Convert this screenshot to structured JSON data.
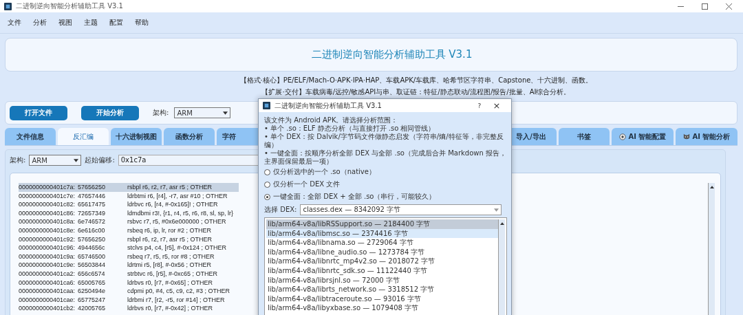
{
  "window": {
    "title": "二进制逆向智能分析辅助工具 V3.1"
  },
  "menu": [
    "文件",
    "分析",
    "视图",
    "主题",
    "配置",
    "帮助"
  ],
  "header": {
    "title": "二进制逆向智能分析辅助工具 V3.1",
    "lines": [
      "【格式·核心】PE/ELF/Mach-O·APK·IPA·HAP、车载APK/车载库、哈希节区字符串、Capstone、十六进制、函数。",
      "【扩展·交付】车载病毒/远控/敏感API与串、取证链：特征/静态联动/流程图/报告/批量、AI综合分析。"
    ]
  },
  "toolbar": {
    "buttons": [
      "打开文件",
      "开始分析"
    ],
    "arch_label": "架构:",
    "arch_value": "ARM"
  },
  "tabs": [
    {
      "label": "文件信息",
      "selected": false,
      "kind": "plain"
    },
    {
      "label": "反汇编",
      "selected": true,
      "kind": "plain"
    },
    {
      "label": "十六进制视图",
      "selected": false,
      "kind": "plain"
    },
    {
      "label": "函数分析",
      "selected": false,
      "kind": "plain"
    },
    {
      "label": "字符",
      "selected": false,
      "kind": "wide"
    },
    {
      "label": "导入/导出",
      "selected": false,
      "kind": "plain"
    },
    {
      "label": "书签",
      "selected": false,
      "kind": "plain"
    },
    {
      "label": "AI 智能配置",
      "selected": false,
      "kind": "gear"
    },
    {
      "label": "AI 智能分析",
      "selected": false,
      "kind": "cat"
    }
  ],
  "disassembly": {
    "arch_label": "架构:",
    "arch_value": "ARM",
    "offset_label": "起始偏移:",
    "offset_value": "0x1c7a",
    "rows": [
      {
        "address": "0000000000401c7a:",
        "bytes": "57656250",
        "instruction": "rsbpl    r6, r2, r7, asr r5  ; OTHER",
        "selected": true
      },
      {
        "address": "0000000000401c7e:",
        "bytes": "47657446",
        "instruction": "ldrbtmi  r6, [r4], -r7, asr #10  ; OTHER",
        "selected": false
      },
      {
        "address": "0000000000401c82:",
        "bytes": "65617475",
        "instruction": "ldrbvc   r6, [r4, #-0x165]!  ; OTHER",
        "selected": false
      },
      {
        "address": "0000000000401c86:",
        "bytes": "72657349",
        "instruction": "ldmdbmi  r3!, {r1, r4, r5, r6, r8, sl, sp, lr}",
        "selected": false
      },
      {
        "address": "0000000000401c8a:",
        "bytes": "6e746572",
        "instruction": "rsbvc    r7, r5, #0x6e000000  ; OTHER",
        "selected": false
      },
      {
        "address": "0000000000401c8e:",
        "bytes": "6e616c00",
        "instruction": "rsbeq    r6, ip, lr, ror #2  ; OTHER",
        "selected": false
      },
      {
        "address": "0000000000401c92:",
        "bytes": "57656250",
        "instruction": "rsbpl    r6, r2, r7, asr r5  ; OTHER",
        "selected": false
      },
      {
        "address": "0000000000401c96:",
        "bytes": "4944656c",
        "instruction": "stclvs   p4, c4, [r5], #-0x124  ; OTHER",
        "selected": false
      },
      {
        "address": "0000000000401c9a:",
        "bytes": "65746500",
        "instruction": "rsbeq    r7, r5, r5, ror #8  ; OTHER",
        "selected": false
      },
      {
        "address": "0000000000401c9e:",
        "bytes": "56503844",
        "instruction": "ldrtmi   r5, [r8], #-0x56  ; OTHER",
        "selected": false
      },
      {
        "address": "0000000000401ca2:",
        "bytes": "656c6574",
        "instruction": "strbtvc  r6, [r5], #-0xc65  ; OTHER",
        "selected": false
      },
      {
        "address": "0000000000401ca6:",
        "bytes": "65005765",
        "instruction": "ldrbvs   r0, [r7, #-0x65]  ; OTHER",
        "selected": false
      },
      {
        "address": "0000000000401caa:",
        "bytes": "6250494e",
        "instruction": "cdpmi    p0, #4, c5, c9, c2, #3  ; OTHER",
        "selected": false
      },
      {
        "address": "0000000000401cae:",
        "bytes": "65775247",
        "instruction": "ldrbmi   r7, [r2, -r5, ror #14]  ; OTHER",
        "selected": false
      },
      {
        "address": "0000000000401cb2:",
        "bytes": "42005765",
        "instruction": "ldrbvs   r0, [r7, #-0x42]  ; OTHER",
        "selected": false
      }
    ]
  },
  "dialog": {
    "title": "二进制逆向智能分析辅助工具 V3.1",
    "help": "?",
    "close": "×",
    "intro": "该文件为 Android APK。请选择分析范围：",
    "bullets": [
      "• 单个 .so：ELF 静态分析（与直接打开 .so 相同管线）",
      "• 单个 DEX：按 Dalvik/字节码文件做静态启发（字符串/熵/特征等，非完整反编）",
      "• 一键全面：按顺序分析全部 DEX 与全部 .so（完成后合并 Markdown 报告，主界面保留最后一项）"
    ],
    "options": [
      {
        "label": "仅分析选中的一个 .so（native）",
        "selected": false
      },
      {
        "label": "仅分析一个 DEX 文件",
        "selected": false
      },
      {
        "label": "一键全面：全部 DEX + 全部 .so（串行，可能较久）",
        "selected": true
      }
    ],
    "dex_label": "选择 DEX:",
    "dex_value": "classes.dex  —  8342092 字节",
    "files": [
      {
        "label": "lib/arm64-v8a/libRSSupport.so  —  2184400 字节",
        "selected": true,
        "hovered": false
      },
      {
        "label": "lib/arm64-v8a/libmsc.so  —  2374416 字节",
        "selected": false,
        "hovered": true
      },
      {
        "label": "lib/arm64-v8a/libnama.so  —  2729064 字节",
        "selected": false,
        "hovered": false
      },
      {
        "label": "lib/arm64-v8a/libne_audio.so  —  1273784 字节",
        "selected": false,
        "hovered": false
      },
      {
        "label": "lib/arm64-v8a/libnrtc_mp4v2.so  —  2018072 字节",
        "selected": false,
        "hovered": false
      },
      {
        "label": "lib/arm64-v8a/libnrtc_sdk.so  —  11122440 字节",
        "selected": false,
        "hovered": false
      },
      {
        "label": "lib/arm64-v8a/librsjnl.so  —  72000 字节",
        "selected": false,
        "hovered": false
      },
      {
        "label": "lib/arm64-v8a/librts_network.so  —  3318512 字节",
        "selected": false,
        "hovered": false
      },
      {
        "label": "lib/arm64-v8a/libtraceroute.so  —  93016 字节",
        "selected": false,
        "hovered": false
      },
      {
        "label": "lib/arm64-v8a/libyxbase.so  —  1079408 字节",
        "selected": false,
        "hovered": false
      }
    ]
  }
}
